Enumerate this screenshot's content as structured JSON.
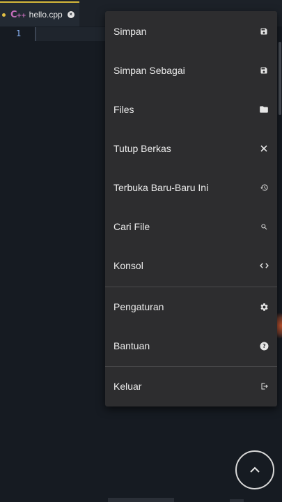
{
  "tab": {
    "lang": "C",
    "lang_sup": "++",
    "filename": "hello.cpp",
    "close": "×"
  },
  "editor": {
    "line_number": "1"
  },
  "menu": {
    "items": [
      {
        "label": "Simpan",
        "icon": "save-icon"
      },
      {
        "label": "Simpan Sebagai",
        "icon": "save-icon"
      },
      {
        "label": "Files",
        "icon": "folder-icon"
      },
      {
        "label": "Tutup Berkas",
        "icon": "close-icon"
      },
      {
        "label": "Terbuka Baru-Baru Ini",
        "icon": "history-icon"
      },
      {
        "label": "Cari File",
        "icon": "search-icon"
      },
      {
        "label": "Konsol",
        "icon": "code-icon"
      },
      {
        "label": "Pengaturan",
        "icon": "gear-icon"
      },
      {
        "label": "Bantuan",
        "icon": "help-icon"
      },
      {
        "label": "Keluar",
        "icon": "logout-icon"
      }
    ]
  },
  "colors": {
    "accent_tab": "#d6b93a",
    "background": "#161b22",
    "menu": "#2d2d2f"
  }
}
